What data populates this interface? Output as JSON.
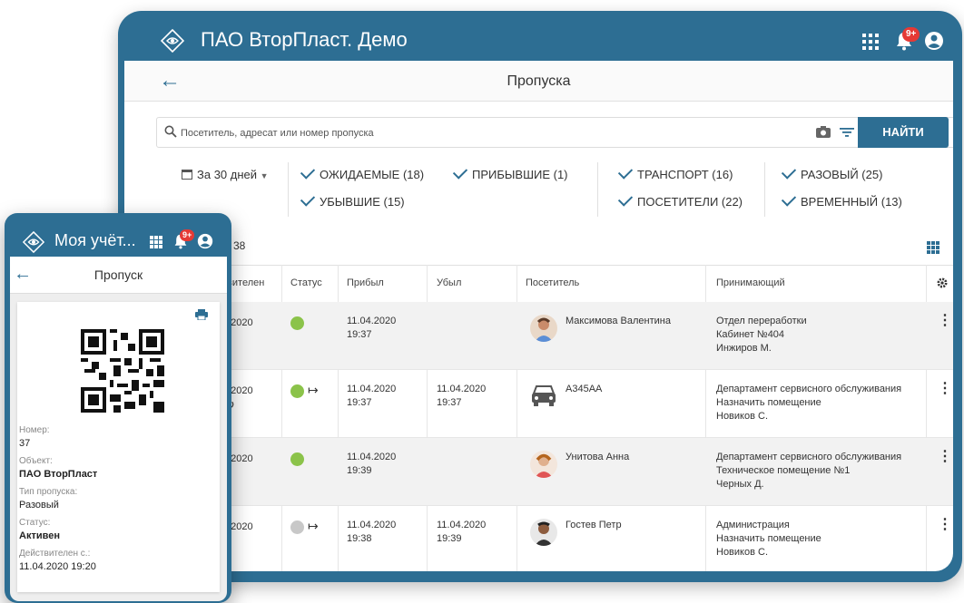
{
  "app": {
    "title": "ПАО ВторПласт. Демо",
    "notifications_badge": "9+"
  },
  "page": {
    "title": "Пропуска"
  },
  "search": {
    "placeholder": "Посетитель, адресат или номер пропуска",
    "button_label": "НАЙТИ"
  },
  "filters": {
    "period": "За 30 дней",
    "chips": [
      "ОЖИДАЕМЫЕ (18)",
      "ПРИБЫВШИЕ (1)",
      "УБЫВШИЕ (15)",
      "ТРАНСПОРТ (16)",
      "ПОСЕТИТЕЛИ (22)",
      "РАЗОВЫЙ (25)",
      "ВРЕМЕННЫЙ (13)"
    ]
  },
  "list": {
    "count": "38",
    "columns": [
      "твителен",
      "Статус",
      "Прибыл",
      "Убыл",
      "Посетитель",
      "Принимающий"
    ],
    "rows": [
      {
        "valid": "4.2020",
        "status": "green",
        "exited": false,
        "arrived": [
          "11.04.2020",
          "19:37"
        ],
        "left": [
          "",
          ""
        ],
        "visitor": "Максимова Валентина",
        "visitor_type": "person",
        "host": [
          "Отдел переработки",
          "Кабинет №404",
          "Инжиров М."
        ]
      },
      {
        "valid": "4.2020",
        "status": "green",
        "exited": true,
        "arrived": [
          "11.04.2020",
          "19:37"
        ],
        "left": [
          "11.04.2020",
          "19:37"
        ],
        "visitor": "А345АА",
        "visitor_type": "car",
        "host": [
          "Департамент сервисного обслуживания",
          "Назначить помещение",
          "Новиков С."
        ]
      },
      {
        "valid": "4.2020",
        "status": "green",
        "exited": false,
        "arrived": [
          "11.04.2020",
          "19:39"
        ],
        "left": [
          "",
          ""
        ],
        "visitor": "Унитова Анна",
        "visitor_type": "person",
        "host": [
          "Департамент сервисного обслуживания",
          "Техническое помещение №1",
          "Черных Д."
        ]
      },
      {
        "valid": "4.2020",
        "status": "grey",
        "exited": true,
        "arrived": [
          "11.04.2020",
          "19:38"
        ],
        "left": [
          "11.04.2020",
          "19:39"
        ],
        "visitor": "Гостев Петр",
        "visitor_type": "person",
        "host": [
          "Администрация",
          "Назначить помещение",
          "Новиков С."
        ]
      }
    ]
  },
  "mobile": {
    "title": "Моя учёт...",
    "notifications_badge": "9+",
    "page_title": "Пропуск",
    "fields": [
      {
        "label": "Номер:",
        "value": "37",
        "bold": false
      },
      {
        "label": "Объект:",
        "value": "ПАО ВторПласт",
        "bold": true
      },
      {
        "label": "Тип пропуска:",
        "value": "Разовый",
        "bold": false
      },
      {
        "label": "Статус:",
        "value": "Активен",
        "bold": true
      },
      {
        "label": "Действителен с.:",
        "value": "11.04.2020 19:20",
        "bold": false
      }
    ]
  },
  "colors": {
    "brand": "#2d6e93",
    "status_active": "#8bc34a",
    "status_inactive": "#c8c8c8",
    "badge": "#e53935"
  },
  "icons": [
    "logo-icon",
    "apps-grid-icon",
    "bell-icon",
    "account-icon",
    "back-arrow-icon",
    "search-icon",
    "camera-icon",
    "filter-icon",
    "calendar-icon",
    "check-icon",
    "view-grid-icon",
    "settings-icon",
    "exit-icon",
    "car-icon",
    "more-vert-icon",
    "print-icon",
    "qr-code"
  ]
}
